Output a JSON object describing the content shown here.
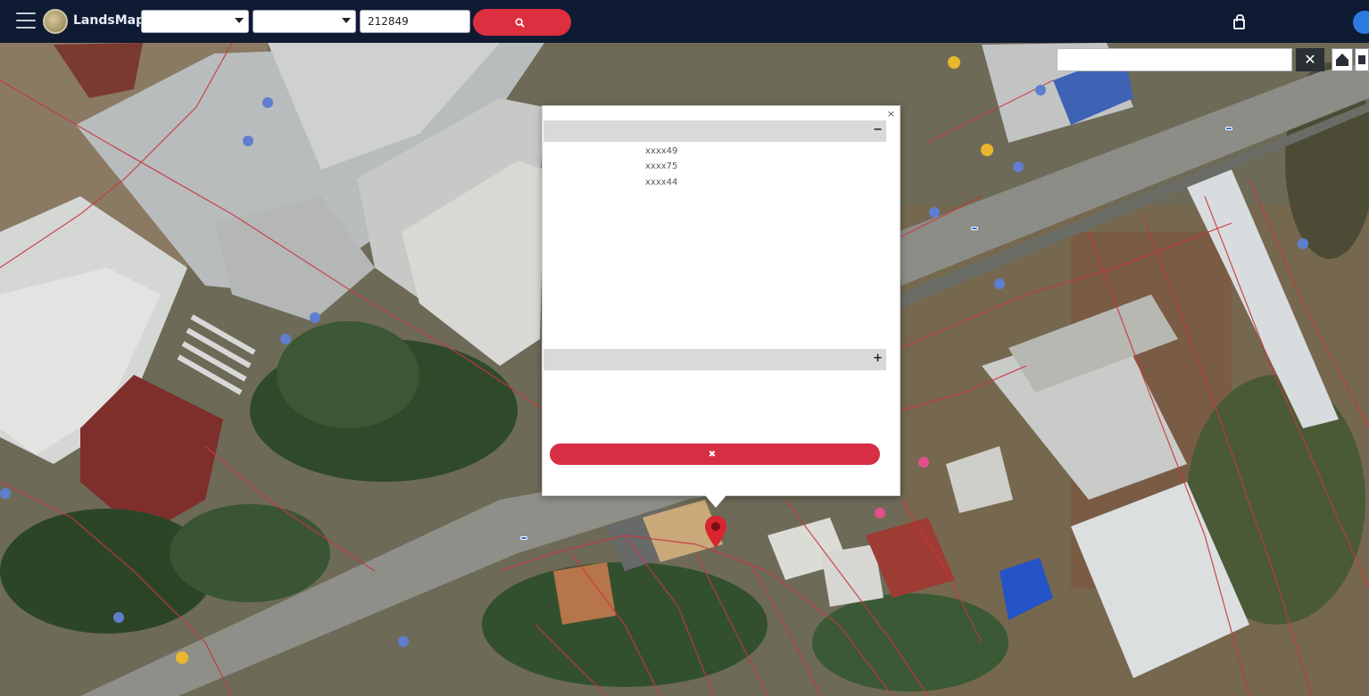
{
  "header": {
    "brand": "LandsMaps",
    "province_select": "",
    "district_select": "",
    "parcel_number": "212849",
    "search_button": "",
    "login_link": ""
  },
  "map": {
    "place_search_placeholder": "",
    "clear_button": "✕",
    "road_labels": [
      "",
      "",
      ""
    ],
    "highway_shields": [
      "",
      "",
      ""
    ]
  },
  "popup": {
    "close": "×",
    "notice": "",
    "section_title": "",
    "section_toggle": "−",
    "rows": [
      {
        "label": "",
        "value": "xxxx49"
      },
      {
        "label": "",
        "value": "xxxx75"
      },
      {
        "label": "",
        "value": "xxxx44"
      },
      {
        "label": "",
        "value": ""
      },
      {
        "label": "",
        "value": ""
      },
      {
        "label": "",
        "value": ""
      },
      {
        "label": "",
        "value": ""
      },
      {
        "label": "",
        "value": ""
      },
      {
        "label": "",
        "value": ""
      },
      {
        "label": "",
        "value": ""
      },
      {
        "label": "",
        "value": ""
      },
      {
        "label": "",
        "value": ""
      },
      {
        "label": "",
        "value": ""
      }
    ],
    "section2_title": "",
    "section2_toggle": "+",
    "dismiss_button": ""
  },
  "colors": {
    "topbar": "#0f1a33",
    "accent_red": "#dc2f3f",
    "link_blue": "#2a78c8",
    "parcel_line": "#c8373f"
  }
}
